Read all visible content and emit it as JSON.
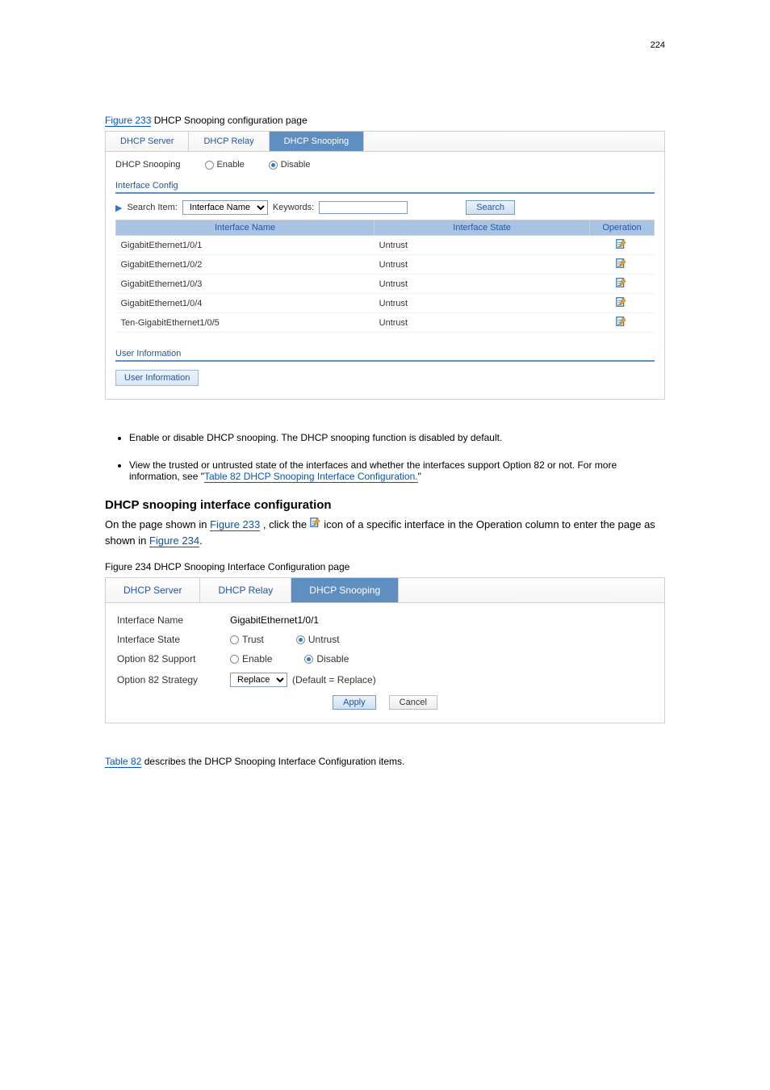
{
  "page_number": "224",
  "figure1": {
    "label_prefix": "Figure 233",
    "label": "DHCP Snooping configuration page",
    "tabs": [
      "DHCP Server",
      "DHCP Relay",
      "DHCP Snooping"
    ],
    "active_tab": 2,
    "snooping_label": "DHCP Snooping",
    "enable": "Enable",
    "disable": "Disable",
    "interface_config": "Interface Config",
    "search_item": "Search Item:",
    "search_select": "Interface Name",
    "keywords": "Keywords:",
    "search_btn": "Search",
    "columns": [
      "Interface Name",
      "Interface State",
      "Operation"
    ],
    "rows": [
      {
        "name": "GigabitEthernet1/0/1",
        "state": "Untrust"
      },
      {
        "name": "GigabitEthernet1/0/2",
        "state": "Untrust"
      },
      {
        "name": "GigabitEthernet1/0/3",
        "state": "Untrust"
      },
      {
        "name": "GigabitEthernet1/0/4",
        "state": "Untrust"
      },
      {
        "name": "Ten-GigabitEthernet1/0/5",
        "state": "Untrust"
      }
    ],
    "user_info_title": "User Information",
    "user_info_btn": "User Information"
  },
  "bullets": [
    "Enable or disable DHCP snooping. The DHCP snooping function is disabled by default.",
    "View the trusted or untrusted state of the interfaces and whether the interfaces support Option 82 or not. For more information, see \""
  ],
  "table_link": "Table 82 DHCP Snooping Interface Configuration.",
  "heading_intf": "DHCP snooping interface configuration",
  "intf_para_prefix": "On the page shown in ",
  "intf_para_link1": "Figure 233",
  "intf_para_middle": ", click the ",
  "intf_para_after_icon": " icon of a specific interface in the",
  "operation_word": "Operation",
  "intf_para_tail": " column to enter the page as shown in ",
  "intf_para_link2": "Figure 234",
  "figure2": {
    "label_prefix": "Figure 234",
    "label": "DHCP Snooping Interface Configuration page",
    "tabs": [
      "DHCP Server",
      "DHCP Relay",
      "DHCP Snooping"
    ],
    "active_tab": 2,
    "intf_name_lbl": "Interface Name",
    "intf_name_val": "GigabitEthernet1/0/1",
    "intf_state_lbl": "Interface State",
    "trust": "Trust",
    "untrust": "Untrust",
    "opt82_support_lbl": "Option 82 Support",
    "enable": "Enable",
    "disable": "Disable",
    "opt82_strategy_lbl": "Option 82 Strategy",
    "opt82_strategy_sel": "Replace",
    "opt82_hint": "(Default = Replace)",
    "apply": "Apply",
    "cancel": "Cancel"
  },
  "table_ref_link": "Table 82",
  "table_ref_tail": " describes the DHCP Snooping Interface Configuration items."
}
